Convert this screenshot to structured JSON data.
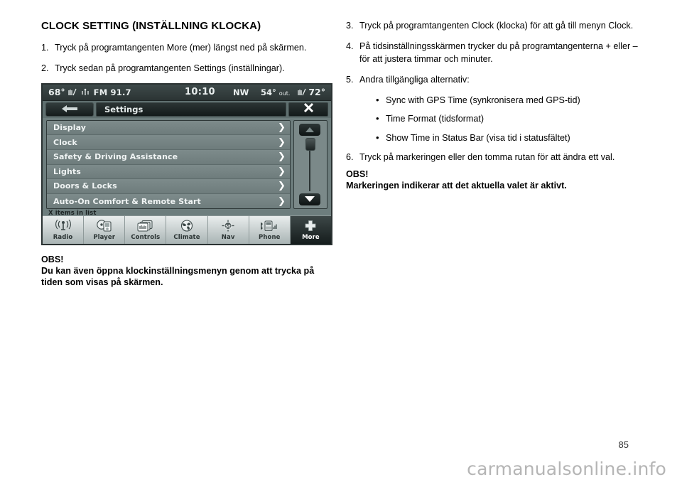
{
  "left_column": {
    "heading": "CLOCK SETTING (INSTÄLLNING KLOCKA)",
    "steps": [
      {
        "num": "1.",
        "text": "Tryck på programtangenten More (mer) längst ned på skärmen."
      },
      {
        "num": "2.",
        "text": "Tryck sedan på programtangenten Settings (inställningar)."
      }
    ],
    "note": {
      "title": "OBS!",
      "body": "Du kan även öppna klockinställningsmenyn genom att trycka på tiden som visas på skärmen."
    }
  },
  "right_column": {
    "steps": [
      {
        "num": "3.",
        "text": "Tryck på programtangenten Clock (klocka) för att gå till menyn Clock."
      },
      {
        "num": "4.",
        "text": "På tidsinställningsskärmen trycker du på programtangenterna + eller – för att justera timmar och minuter."
      },
      {
        "num": "5.",
        "text": "Andra tillgängliga alternativ:"
      }
    ],
    "bullets": [
      "Sync with GPS Time (synkronisera med GPS-tid)",
      "Time Format (tidsformat)",
      "Show Time in Status Bar (visa tid i statusfältet)"
    ],
    "step6": {
      "num": "6.",
      "text": "Tryck på markeringen eller den tomma rutan för att ändra ett val."
    },
    "note": {
      "title": "OBS!",
      "body": "Markeringen indikerar att det aktuella valet är aktivt."
    }
  },
  "radio_screen": {
    "status_bar": {
      "cabin_temp": "68°",
      "left_icon_1": "seat-heater-icon",
      "left_icon_2": "radio-antenna-icon",
      "station": "FM 91.7",
      "clock": "10:10",
      "compass": "NW",
      "outside_temp": "54°",
      "outside_label": "out.",
      "right_icon": "seat-heater-icon",
      "right_temp": "72°"
    },
    "title_bar": {
      "back_icon": "back-arrow-icon",
      "title": "Settings",
      "close_icon": "close-icon"
    },
    "menu_items": [
      "Display",
      "Clock",
      "Safety & Driving Assistance",
      "Lights",
      "Doors & Locks",
      "Auto-On Comfort & Remote Start"
    ],
    "chevron": "❯",
    "scrollbar": {
      "up_icon": "scroll-up-arrow-icon",
      "down_icon": "scroll-down-arrow-icon"
    },
    "item_count_label": "X items in list",
    "toolbar": [
      {
        "label": "Radio",
        "icon": "radio-tower-icon",
        "active": false
      },
      {
        "label": "Player",
        "icon": "media-player-icon",
        "active": false
      },
      {
        "label": "Controls",
        "icon": "controls-icon",
        "active": false
      },
      {
        "label": "Climate",
        "icon": "climate-fan-icon",
        "active": false
      },
      {
        "label": "Nav",
        "icon": "navigation-icon",
        "active": false
      },
      {
        "label": "Phone",
        "icon": "phone-icon",
        "active": false
      },
      {
        "label": "More",
        "icon": "plus-icon",
        "active": true
      }
    ]
  },
  "footer": {
    "page_number": "85",
    "watermark": "carmanualsonline.info"
  }
}
